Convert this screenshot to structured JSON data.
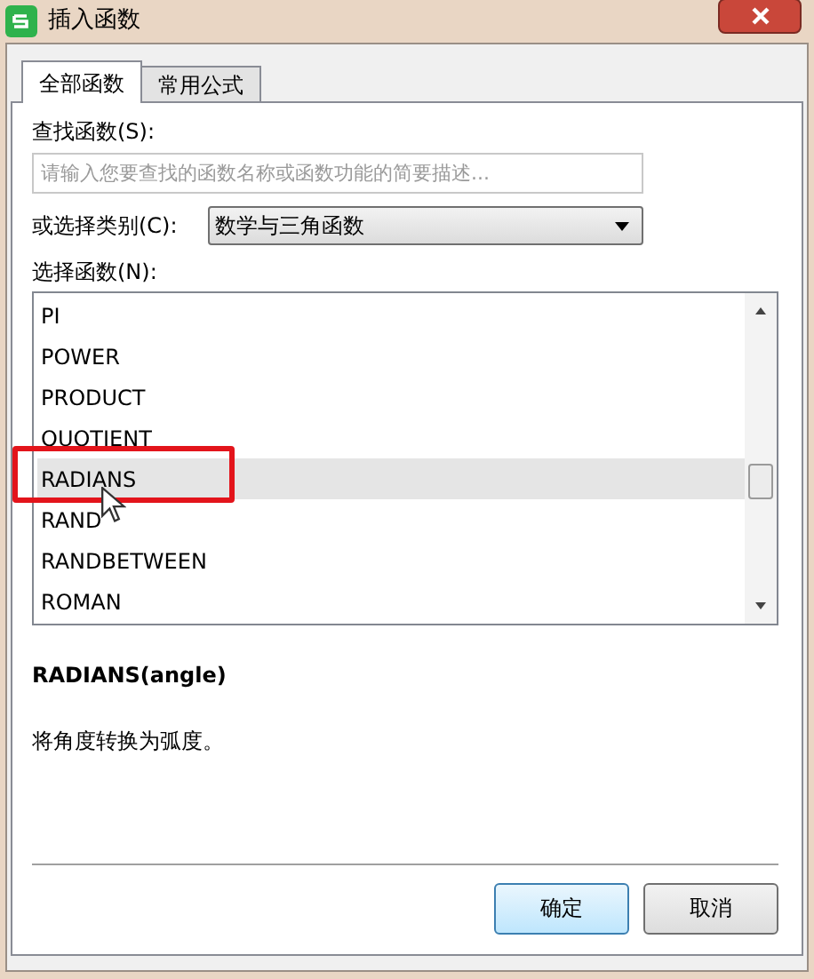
{
  "window": {
    "title": "插入函数"
  },
  "tabs": [
    {
      "label": "全部函数",
      "selected": true
    },
    {
      "label": "常用公式",
      "selected": false
    }
  ],
  "search": {
    "label": "查找函数(S):",
    "placeholder": "请输入您要查找的函数名称或函数功能的简要描述..."
  },
  "category": {
    "label": "或选择类别(C):",
    "value": "数学与三角函数"
  },
  "functions": {
    "label": "选择函数(N):",
    "items": [
      {
        "name": "PI",
        "selected": false
      },
      {
        "name": "POWER",
        "selected": false
      },
      {
        "name": "PRODUCT",
        "selected": false
      },
      {
        "name": "QUOTIENT",
        "selected": false
      },
      {
        "name": "RADIANS",
        "selected": true
      },
      {
        "name": "RAND",
        "selected": false
      },
      {
        "name": "RANDBETWEEN",
        "selected": false
      },
      {
        "name": "ROMAN",
        "selected": false
      }
    ]
  },
  "signature": "RADIANS(angle)",
  "description": "将角度转换为弧度。",
  "buttons": [
    {
      "label": "确定",
      "kind": "default"
    },
    {
      "label": "取消",
      "kind": "normal"
    }
  ]
}
